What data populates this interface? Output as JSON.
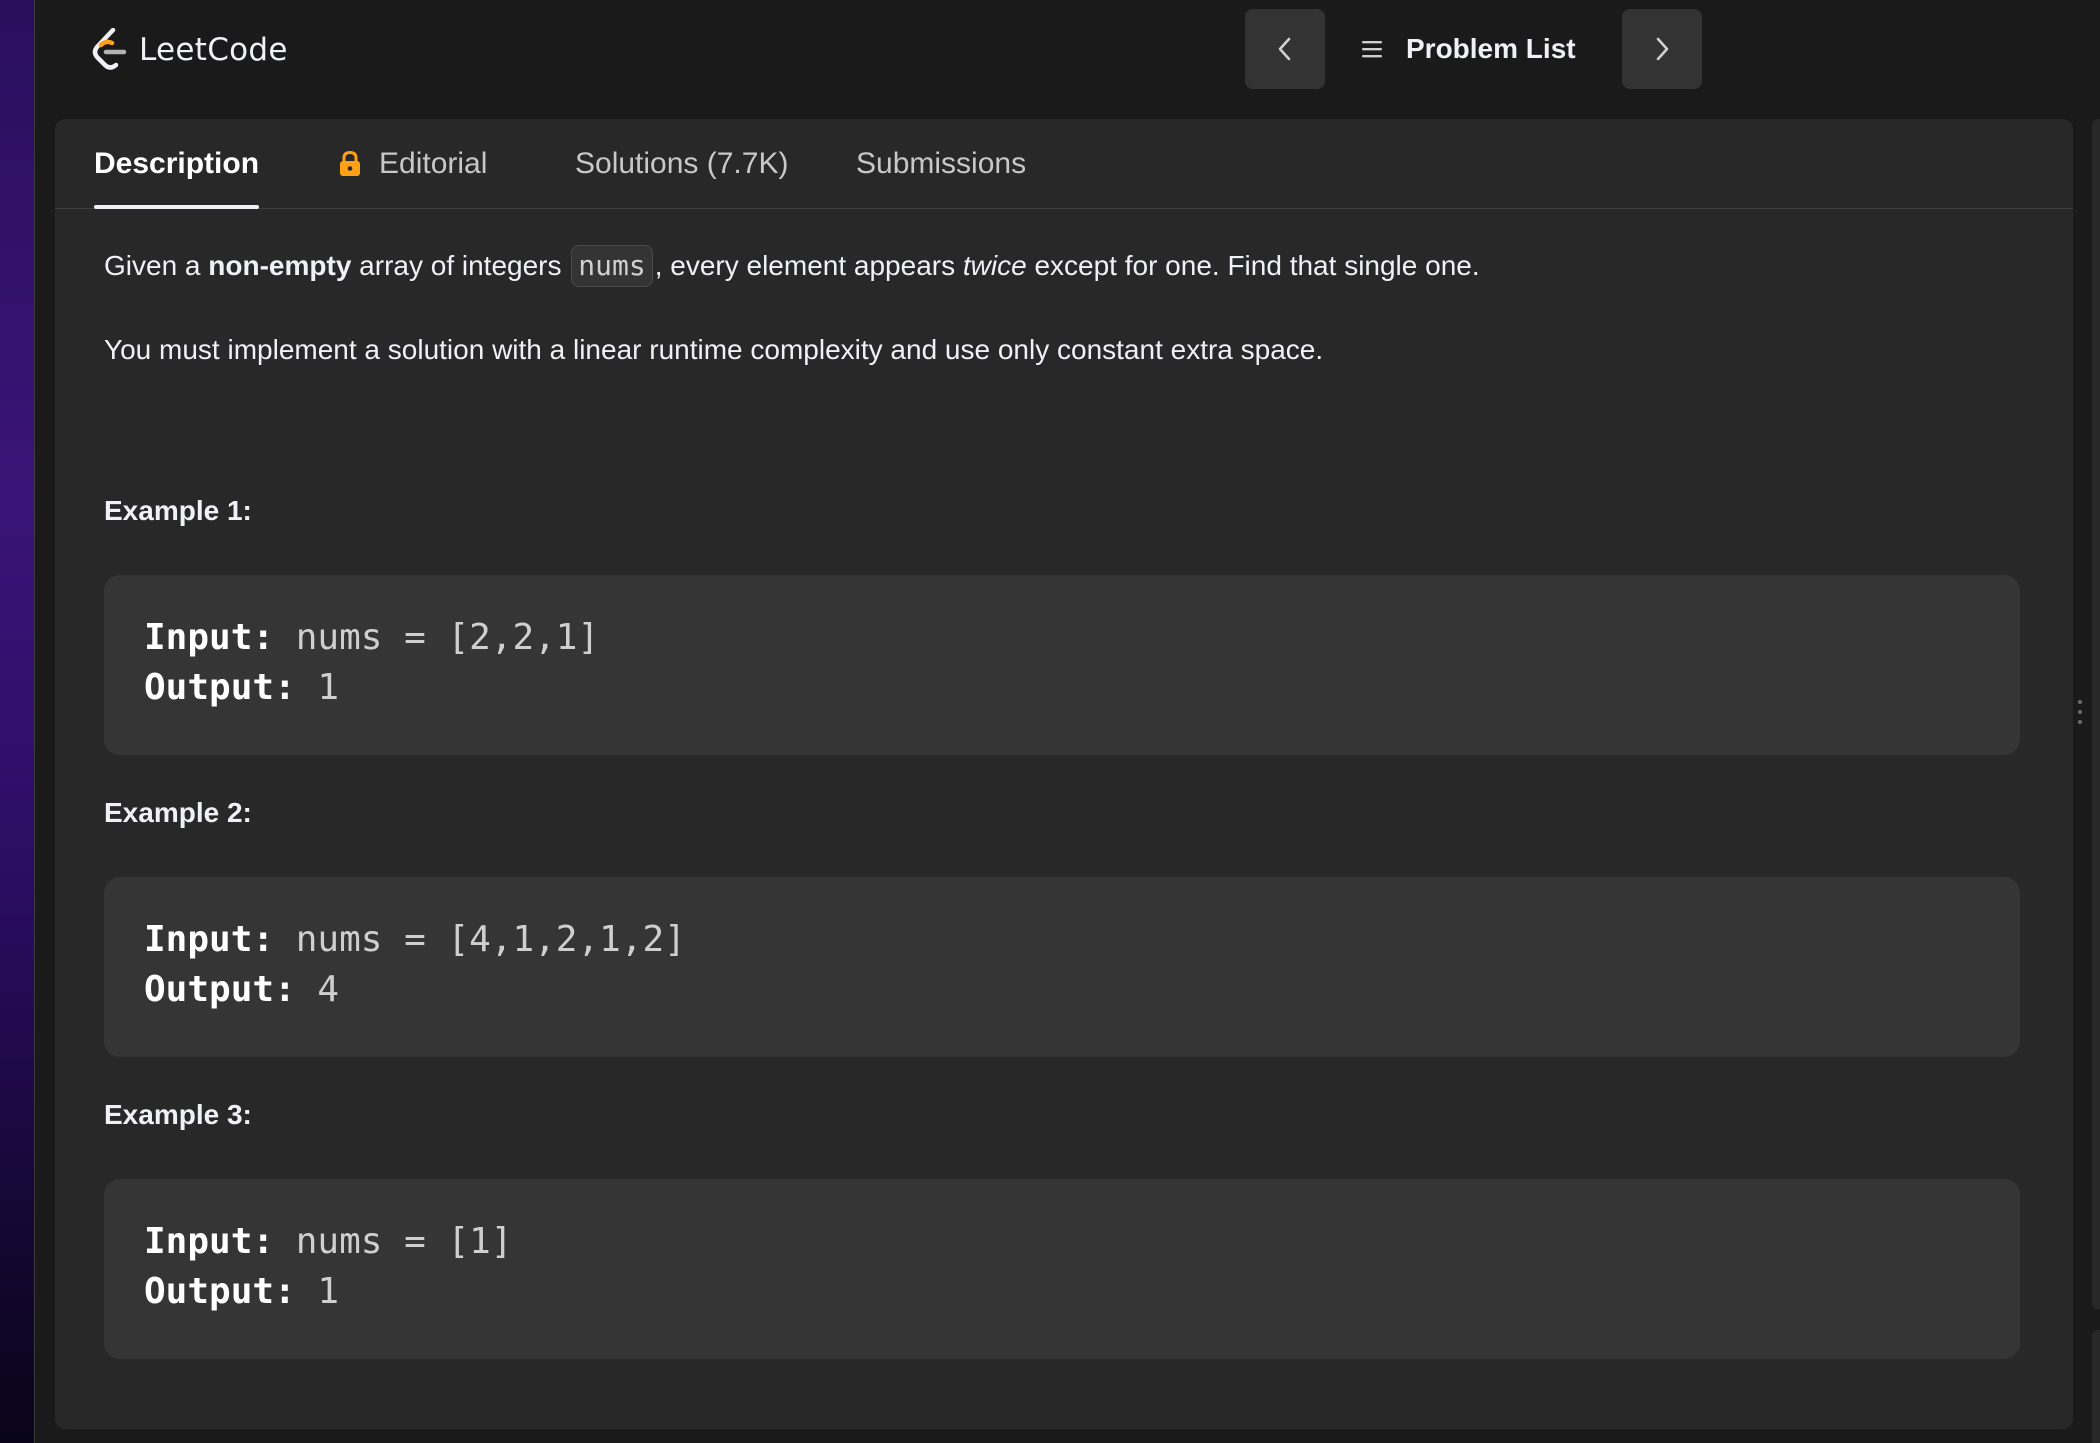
{
  "app": {
    "logo_text": "LeetCode"
  },
  "header": {
    "prev_label": "Previous problem",
    "problem_list_label": "Problem List",
    "next_label": "Next problem"
  },
  "tabs": [
    {
      "label": "Description",
      "active": true
    },
    {
      "label": "Editorial",
      "icon": "lock-icon",
      "active": false
    },
    {
      "label": "Solutions (7.7K)",
      "active": false
    },
    {
      "label": "Submissions",
      "active": false
    }
  ],
  "description": {
    "p1_pre": "Given a ",
    "p1_bold": "non-empty",
    "p1_mid": " array of integers ",
    "p1_code": "nums",
    "p1_mid2": ", every element appears ",
    "p1_italic": "twice",
    "p1_post": " except for one. Find that single one.",
    "p2": "You must implement a solution with a linear runtime complexity and use only constant extra space."
  },
  "examples": [
    {
      "title": "Example 1:",
      "input_key": "Input:",
      "input_val": " nums = [2,2,1]",
      "output_key": "Output:",
      "output_val": " 1"
    },
    {
      "title": "Example 2:",
      "input_key": "Input:",
      "input_val": " nums = [4,1,2,1,2]",
      "output_key": "Output:",
      "output_val": " 4"
    },
    {
      "title": "Example 3:",
      "input_key": "Input:",
      "input_val": " nums = [1]",
      "output_key": "Output:",
      "output_val": " 1"
    }
  ],
  "colors": {
    "accent_lock": "#ffa116",
    "panel_bg": "#282828",
    "app_bg": "#1a1a1a"
  }
}
